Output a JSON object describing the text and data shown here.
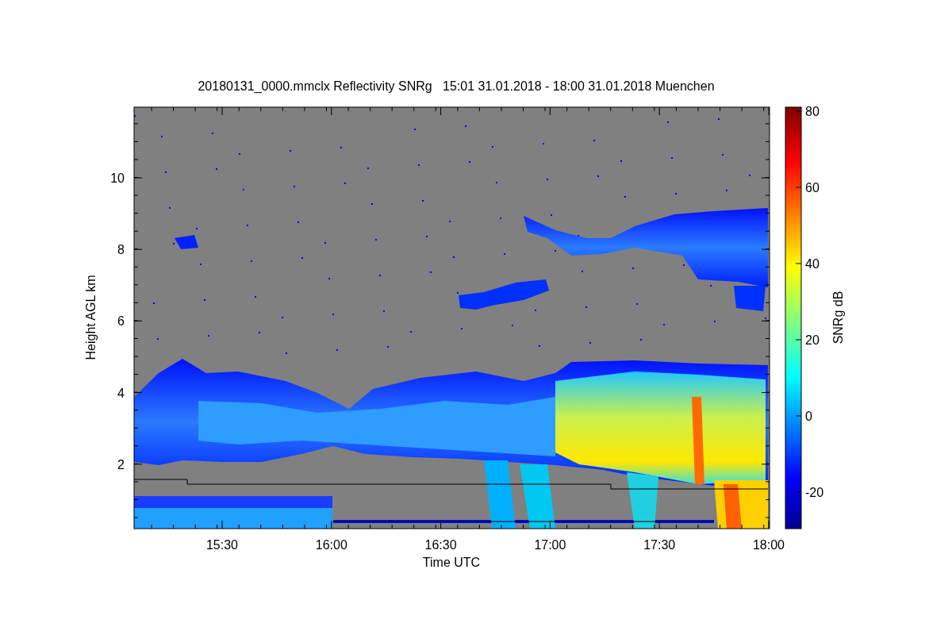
{
  "title": "20180131_0000.mmclx Reflectivity SNRg   15:01 31.01.2018 - 18:00 31.01.2018 Muenchen",
  "plot": {
    "ylabel": "Height AGL km",
    "xlabel": "Time UTC",
    "yticks": [
      "10",
      "8",
      "6",
      "4",
      "2"
    ],
    "xticks": [
      "15:30",
      "16:00",
      "16:30",
      "17:00",
      "17:30",
      "18:00"
    ]
  },
  "colorbar": {
    "label": "SNRg dB",
    "ticks": [
      "80",
      "60",
      "40",
      "20",
      "0",
      "-20"
    ]
  }
}
